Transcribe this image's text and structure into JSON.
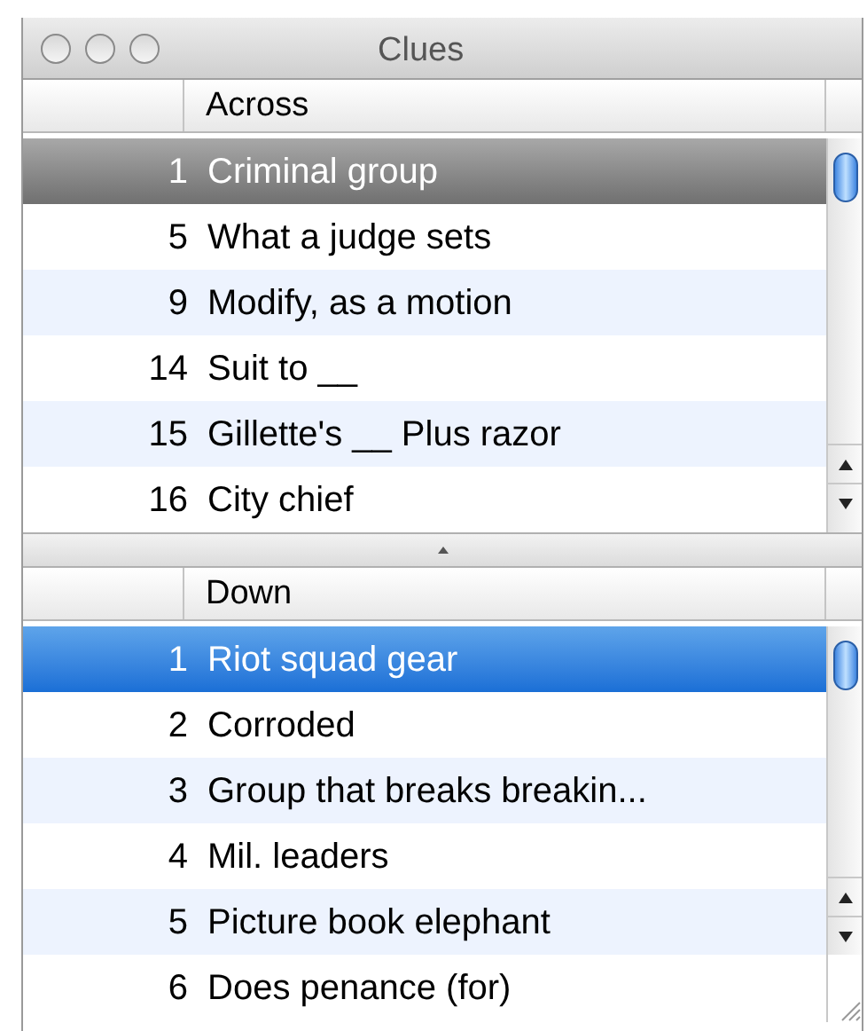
{
  "window": {
    "title": "Clues"
  },
  "panes": [
    {
      "header": "Across",
      "active": false,
      "clues": [
        {
          "number": "1",
          "text": "Criminal group",
          "selected": true
        },
        {
          "number": "5",
          "text": "What a judge sets",
          "selected": false
        },
        {
          "number": "9",
          "text": "Modify, as a motion",
          "selected": false
        },
        {
          "number": "14",
          "text": "Suit to __",
          "selected": false
        },
        {
          "number": "15",
          "text": "Gillette's __ Plus razor",
          "selected": false
        },
        {
          "number": "16",
          "text": "City chief",
          "selected": false
        }
      ]
    },
    {
      "header": "Down",
      "active": true,
      "clues": [
        {
          "number": "1",
          "text": "Riot squad gear",
          "selected": true
        },
        {
          "number": "2",
          "text": "Corroded",
          "selected": false
        },
        {
          "number": "3",
          "text": "Group that breaks breakin...",
          "selected": false
        },
        {
          "number": "4",
          "text": "Mil. leaders",
          "selected": false
        },
        {
          "number": "5",
          "text": "Picture book elephant",
          "selected": false
        },
        {
          "number": "6",
          "text": "Does penance (for)",
          "selected": false
        }
      ]
    }
  ]
}
